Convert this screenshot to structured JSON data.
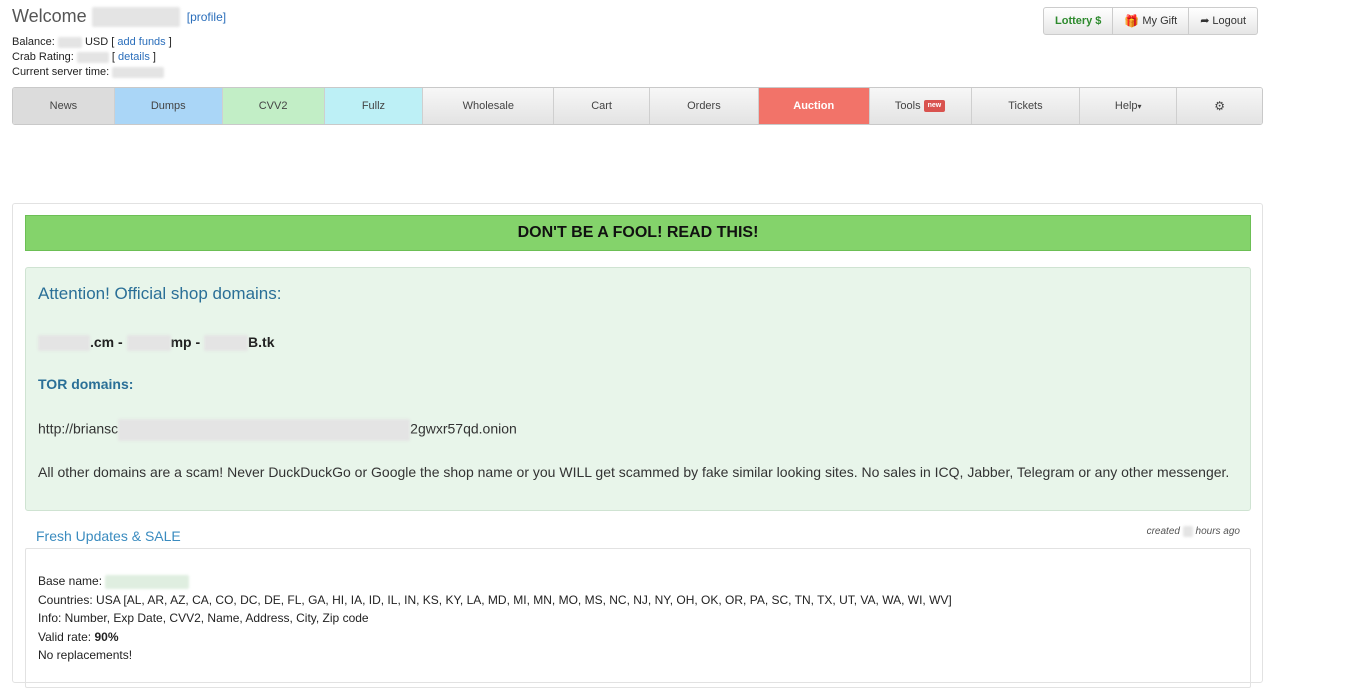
{
  "header": {
    "welcome": "Welcome",
    "profile_link": "[profile]",
    "balance_label": "Balance:",
    "balance_currency": "USD",
    "add_funds_open": "[",
    "add_funds": "add funds",
    "add_funds_close": "]",
    "crab_rating_label": "Crab Rating:",
    "details_open": "[",
    "details": "details",
    "details_close": "]",
    "server_time_label": "Current server time:"
  },
  "top_buttons": {
    "lottery": "Lottery",
    "lottery_symbol": "$",
    "gift": "My Gift",
    "logout": "Logout"
  },
  "nav": {
    "items": [
      {
        "label": "News"
      },
      {
        "label": "Dumps"
      },
      {
        "label": "CVV2"
      },
      {
        "label": "Fullz"
      },
      {
        "label": "Wholesale"
      },
      {
        "label": "Cart"
      },
      {
        "label": "Orders"
      },
      {
        "label": "Auction"
      },
      {
        "label": "Tools",
        "badge": "new"
      },
      {
        "label": "Tickets"
      },
      {
        "label": "Help"
      }
    ]
  },
  "banner": "DON'T BE A FOOL! READ THIS!",
  "notice": {
    "title": "Attention! Official shop domains:",
    "domain1_suffix": ".cm -",
    "domain2_suffix": "mp -",
    "domain3_suffix": "B.tk",
    "tor_title": "TOR domains:",
    "onion_prefix": "http://briansc",
    "onion_suffix": "2gwxr57qd.onion",
    "scam_text": "All other domains are a scam! Never DuckDuckGo or Google the shop name or you WILL get scammed by fake similar looking sites. No sales in ICQ, Jabber, Telegram or any other messenger."
  },
  "updates": {
    "title": "Fresh Updates & SALE",
    "created_prefix": "created",
    "created_suffix": "hours ago",
    "base_name_label": "Base name:",
    "countries": "Countries: USA [AL, AR, AZ, CA, CO, DC, DE, FL, GA, HI, IA, ID, IL, IN, KS, KY, LA, MD, MI, MN, MO, MS, NC, NJ, NY, OH, OK, OR, PA, SC, TN, TX, UT, VA, WA, WI, WV]",
    "info": "Info: Number, Exp Date, CVV2, Name, Address, City, Zip code",
    "valid_rate_label": "Valid rate:",
    "valid_rate_value": "90%",
    "replacements": "No replacements!"
  },
  "colors": {
    "banner": "#84d36b",
    "notice_bg": "#e8f5ea",
    "auction": "#f27369",
    "dumps": "#aad6f7",
    "cvv2": "#c2eec6",
    "fullz": "#bdf0f6",
    "link": "#2a6ebb"
  }
}
